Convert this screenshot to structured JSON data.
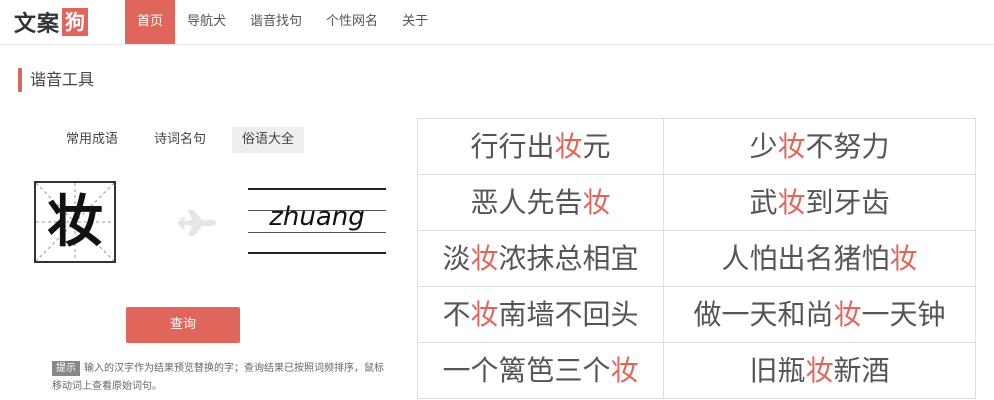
{
  "brand": {
    "logo_text": "文案",
    "logo_box": "狗"
  },
  "nav": {
    "items": [
      "首页",
      "导航犬",
      "谐音找句",
      "个性网名",
      "关于"
    ],
    "active": 0
  },
  "section": {
    "title": "谐音工具"
  },
  "tool": {
    "tabs": [
      "常用成语",
      "诗词名句",
      "俗语大全"
    ],
    "active_tab": 2,
    "character": "妆",
    "pinyin": "zhuang",
    "query_label": "查询",
    "tip_badge": "提示",
    "tip_text": "输入的汉字作为结果预览替换的字；查询结果已按照词频排序，鼠标移动词上查看原始词句。"
  },
  "results": {
    "highlight_color": "#e0655a",
    "rows": [
      [
        {
          "pre": "行行出",
          "hl": "妆",
          "post": "元"
        },
        {
          "pre": "少",
          "hl": "妆",
          "post": "不努力"
        }
      ],
      [
        {
          "pre": "恶人先告",
          "hl": "妆",
          "post": ""
        },
        {
          "pre": "武",
          "hl": "妆",
          "post": "到牙齿"
        }
      ],
      [
        {
          "pre": "淡",
          "hl": "妆",
          "post": "浓抹总相宜"
        },
        {
          "pre": "人怕出名猪怕",
          "hl": "妆",
          "post": ""
        }
      ],
      [
        {
          "pre": "不",
          "hl": "妆",
          "post": "南墙不回头"
        },
        {
          "pre": "做一天和尚",
          "hl": "妆",
          "post": "一天钟"
        }
      ],
      [
        {
          "pre": "一个篱笆三个",
          "hl": "妆",
          "post": ""
        },
        {
          "pre": "旧瓶",
          "hl": "妆",
          "post": "新酒"
        }
      ]
    ]
  },
  "colors": {
    "accent": "#e0655a"
  },
  "icons": {
    "arrow": "airplane-icon"
  }
}
